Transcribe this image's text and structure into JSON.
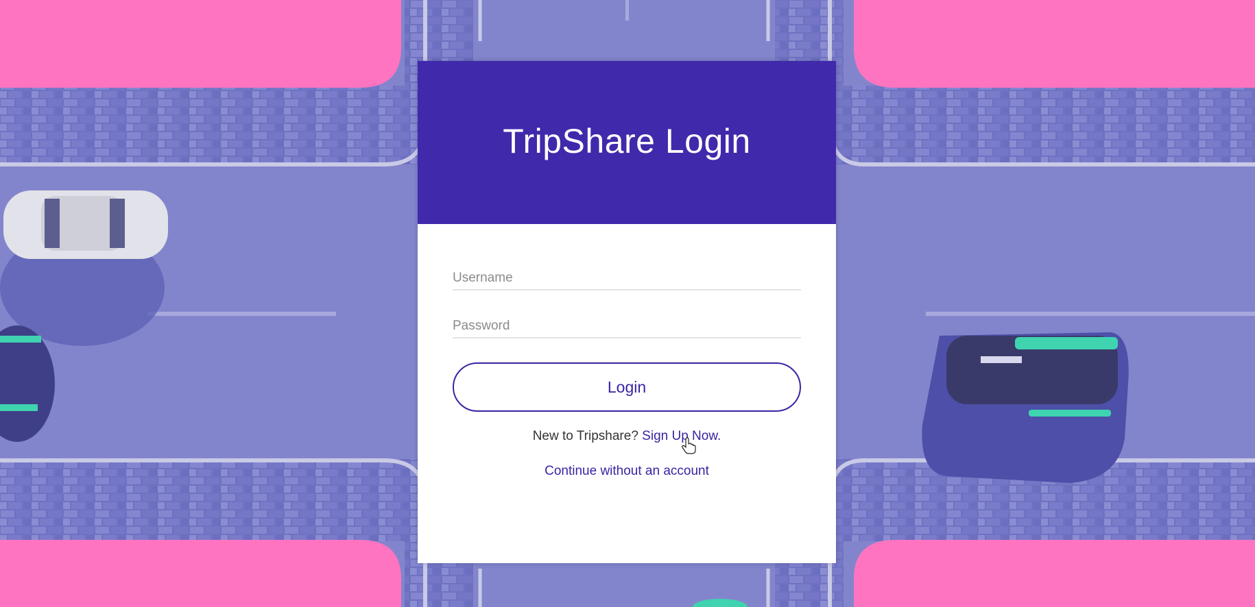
{
  "app": {
    "title": "TripShare Login"
  },
  "form": {
    "username_placeholder": "Username",
    "password_placeholder": "Password",
    "username_value": "",
    "password_value": "",
    "login_label": "Login"
  },
  "links": {
    "signup_prompt": "New to Tripshare?",
    "signup_label": "Sign Up Now.",
    "continue_label": "Continue without an account"
  },
  "colors": {
    "brand": "#4129ab",
    "accent": "#3a23a3",
    "background_overlay": "#7d7fc7",
    "pink_panel": "#ff74c0",
    "card_bg": "#ffffff"
  },
  "icons": {
    "cursor": "hand-pointer-icon"
  }
}
